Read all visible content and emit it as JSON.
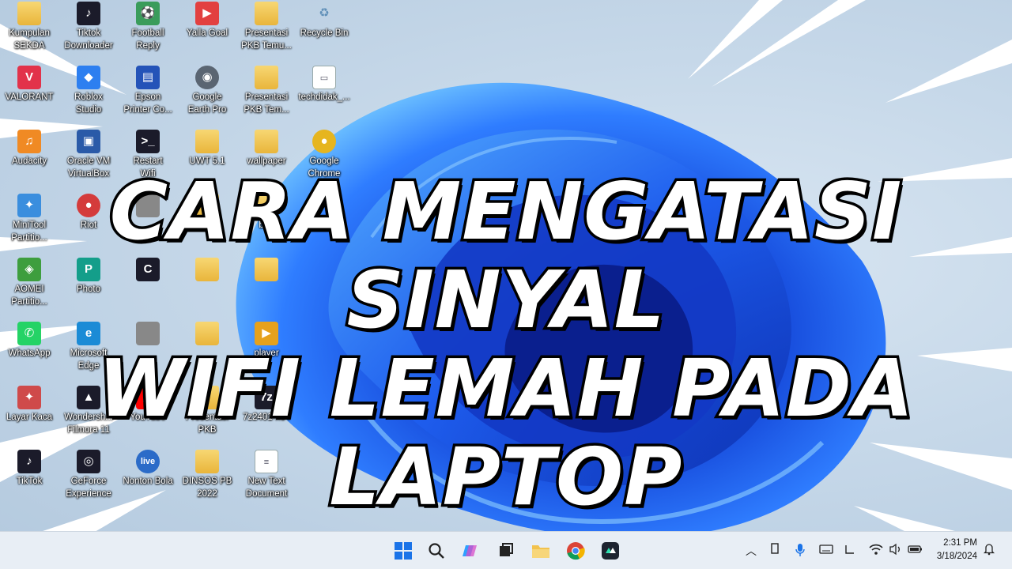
{
  "headline": {
    "line1": "CARA MENGATASI SINYAL",
    "line2": "WIFI LEMAH PADA LAPTOP"
  },
  "desktop_icons": [
    {
      "label": "Kumpulan\nSEKDA",
      "icon": "folder-icon"
    },
    {
      "label": "Tiktok\nDownloader",
      "icon": "tiktok-downloader-icon"
    },
    {
      "label": "Football\nReply",
      "icon": "football-icon"
    },
    {
      "label": "Yalla Goal",
      "icon": "yalla-icon"
    },
    {
      "label": "Presentasi\nPKB Temu...",
      "icon": "folder-icon"
    },
    {
      "label": "Recycle Bin",
      "icon": "recycle-bin-icon"
    },
    {
      "label": "VALORANT",
      "icon": "valorant-icon"
    },
    {
      "label": "Roblox\nStudio",
      "icon": "roblox-studio-icon"
    },
    {
      "label": "Epson\nPrinter Co...",
      "icon": "epson-printer-icon"
    },
    {
      "label": "Google\nEarth Pro",
      "icon": "google-earth-icon"
    },
    {
      "label": "Presentasi\nPKB Tem...",
      "icon": "folder-icon"
    },
    {
      "label": "techdidak_...",
      "icon": "image-file-icon"
    },
    {
      "label": "Audacity",
      "icon": "audacity-icon"
    },
    {
      "label": "Oracle VM\nVirtualBox",
      "icon": "virtualbox-icon"
    },
    {
      "label": "Restart\nWifi",
      "icon": "terminal-icon"
    },
    {
      "label": "UWT 5.1",
      "icon": "folder-icon"
    },
    {
      "label": "wallpaper",
      "icon": "folder-icon"
    },
    {
      "label": "Google\nChrome",
      "icon": "chrome-icon"
    },
    {
      "label": "MiniTool\nPartitio...",
      "icon": "minitool-icon"
    },
    {
      "label": "Riot",
      "icon": "riot-icon"
    },
    {
      "label": "",
      "icon": "app-icon"
    },
    {
      "label": "",
      "icon": "folder-icon"
    },
    {
      "label": "ban",
      "icon": "folder-icon"
    },
    {
      "label": "AOMEI\nPartitio...",
      "icon": "aomei-icon"
    },
    {
      "label": "Photo",
      "icon": "photopea-icon"
    },
    {
      "label": "",
      "icon": "capcut-icon"
    },
    {
      "label": "",
      "icon": "folder-icon"
    },
    {
      "label": "",
      "icon": "folder-icon"
    },
    {
      "label": "WhatsApp",
      "icon": "whatsapp-icon"
    },
    {
      "label": "Microsoft\nEdge",
      "icon": "edge-icon"
    },
    {
      "label": "",
      "icon": "app-icon"
    },
    {
      "label": "",
      "icon": "folder-icon"
    },
    {
      "label": "player",
      "icon": "player-icon"
    },
    {
      "label": "Layar Kaca",
      "icon": "layar-kaca-icon"
    },
    {
      "label": "Wondersh...\nFilmora 11",
      "icon": "filmora-icon"
    },
    {
      "label": "YouTube",
      "icon": "youtube-icon"
    },
    {
      "label": "Presentasi\nPKB",
      "icon": "folder-icon"
    },
    {
      "label": "7z2401-x64",
      "icon": "7zip-icon"
    },
    {
      "label": "TikTok",
      "icon": "tiktok-icon"
    },
    {
      "label": "GeForce\nExperience",
      "icon": "geforce-icon"
    },
    {
      "label": "Nonton Bola",
      "icon": "nonton-bola-icon"
    },
    {
      "label": "DINSOS PB\n2022",
      "icon": "folder-icon"
    },
    {
      "label": "New Text\nDocument",
      "icon": "text-document-icon"
    }
  ],
  "taskbar": {
    "apps": [
      "start-icon",
      "search-icon",
      "copilot-icon",
      "task-view-icon",
      "file-explorer-icon",
      "chrome-icon",
      "filmora-icon"
    ],
    "tray": [
      "chevron-up-icon",
      "usb-icon",
      "microphone-icon",
      "keyboard-icon",
      "display-icon",
      "wifi-icon",
      "volume-icon",
      "battery-icon"
    ],
    "time": "2:31 PM",
    "date": "3/18/2024",
    "notification_icon": "bell-icon"
  },
  "colors": {
    "bloom_dark": "#0b2fb0",
    "bloom_mid": "#1d5cf0",
    "bloom_light": "#4aa3ff",
    "taskbar_bg": "#e8eef5"
  }
}
